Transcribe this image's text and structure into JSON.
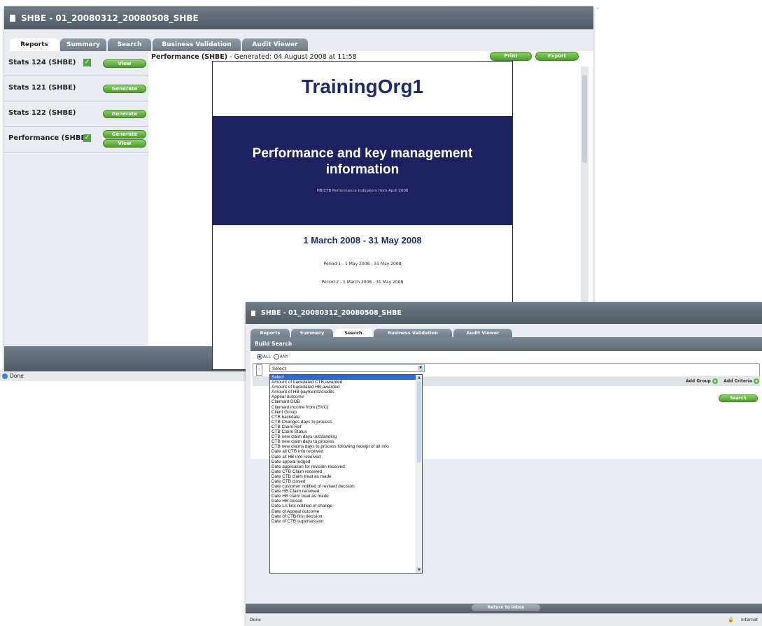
{
  "win1": {
    "title": "SHBE - 01_20080312_20080508_SHBE",
    "tabs": [
      "Reports",
      "Summary",
      "Search",
      "Business Validation",
      "Audit Viewer"
    ],
    "reports": [
      {
        "label": "Stats 124 (SHBE)",
        "checked": true,
        "buttons": [
          "View"
        ]
      },
      {
        "label": "Stats 121 (SHBE)",
        "checked": false,
        "buttons": [
          "Generate"
        ]
      },
      {
        "label": "Stats 122 (SHBE)",
        "checked": false,
        "buttons": [
          "Generate"
        ]
      },
      {
        "label": "Performance (SHBE)",
        "checked": true,
        "buttons": [
          "Generate",
          "View"
        ]
      }
    ],
    "generated_name": "Performance (SHBE)",
    "generated_info": " - Generated: 04 August 2008 at 11:58",
    "print_label": "Print",
    "export_label": "Export",
    "report": {
      "org": "TrainingOrg1",
      "heading": "Performance and key management information",
      "subheading": "HB/CTB Performance Indicators from April 2008",
      "date_range": "1 March 2008 - 31 May 2008",
      "period1": "Period 1 - 1 May 2008 - 31 May 2008",
      "period2": "Period 2 - 1 March 2008 - 31 May 2008"
    },
    "status": "Done"
  },
  "win2": {
    "title": "SHBE - 01_20080312_20080508_SHBE",
    "tabs": [
      "Reports",
      "Summary",
      "Search",
      "Business Validation",
      "Audit Viewer"
    ],
    "build_search": "Build Search",
    "match_all": "ALL",
    "match_any": "ANY",
    "select_value": "Select",
    "add_group": "Add Group",
    "add_criteria": "Add Criteria",
    "search_label": "Search",
    "return_label": "Return to inbox",
    "status": "Done",
    "status_right": "Internet",
    "options": [
      "Select",
      "Amount of backdated CTB awarded",
      "Amount of backdated HB awarded",
      "Amount of HB payments/credits",
      "Appeal outcome",
      "Claimant DOB",
      "Claimant income from (SVC)",
      "Client Group",
      "CTB backdate",
      "CTB Changes days to process",
      "CTB Claim Ref",
      "CTB Claim Status",
      "CTB new claim days outstanding",
      "CTB new claim days to process",
      "CTB new claims days to process following receipt of all info",
      "Date all CTB info received",
      "Date all HB info received",
      "Date appeal lodged",
      "Date application for revision received",
      "Date CTB Claim received",
      "Date CTB claim treat as made",
      "Date CTB closed",
      "Date customer notified of revised decision",
      "Date HB Claim received",
      "Date HB claim treat as made",
      "Date HB closed",
      "Date LA first notified of change",
      "Date of Appeal outcome",
      "Date of CTB first decision",
      "Date of CTB supersession"
    ]
  }
}
